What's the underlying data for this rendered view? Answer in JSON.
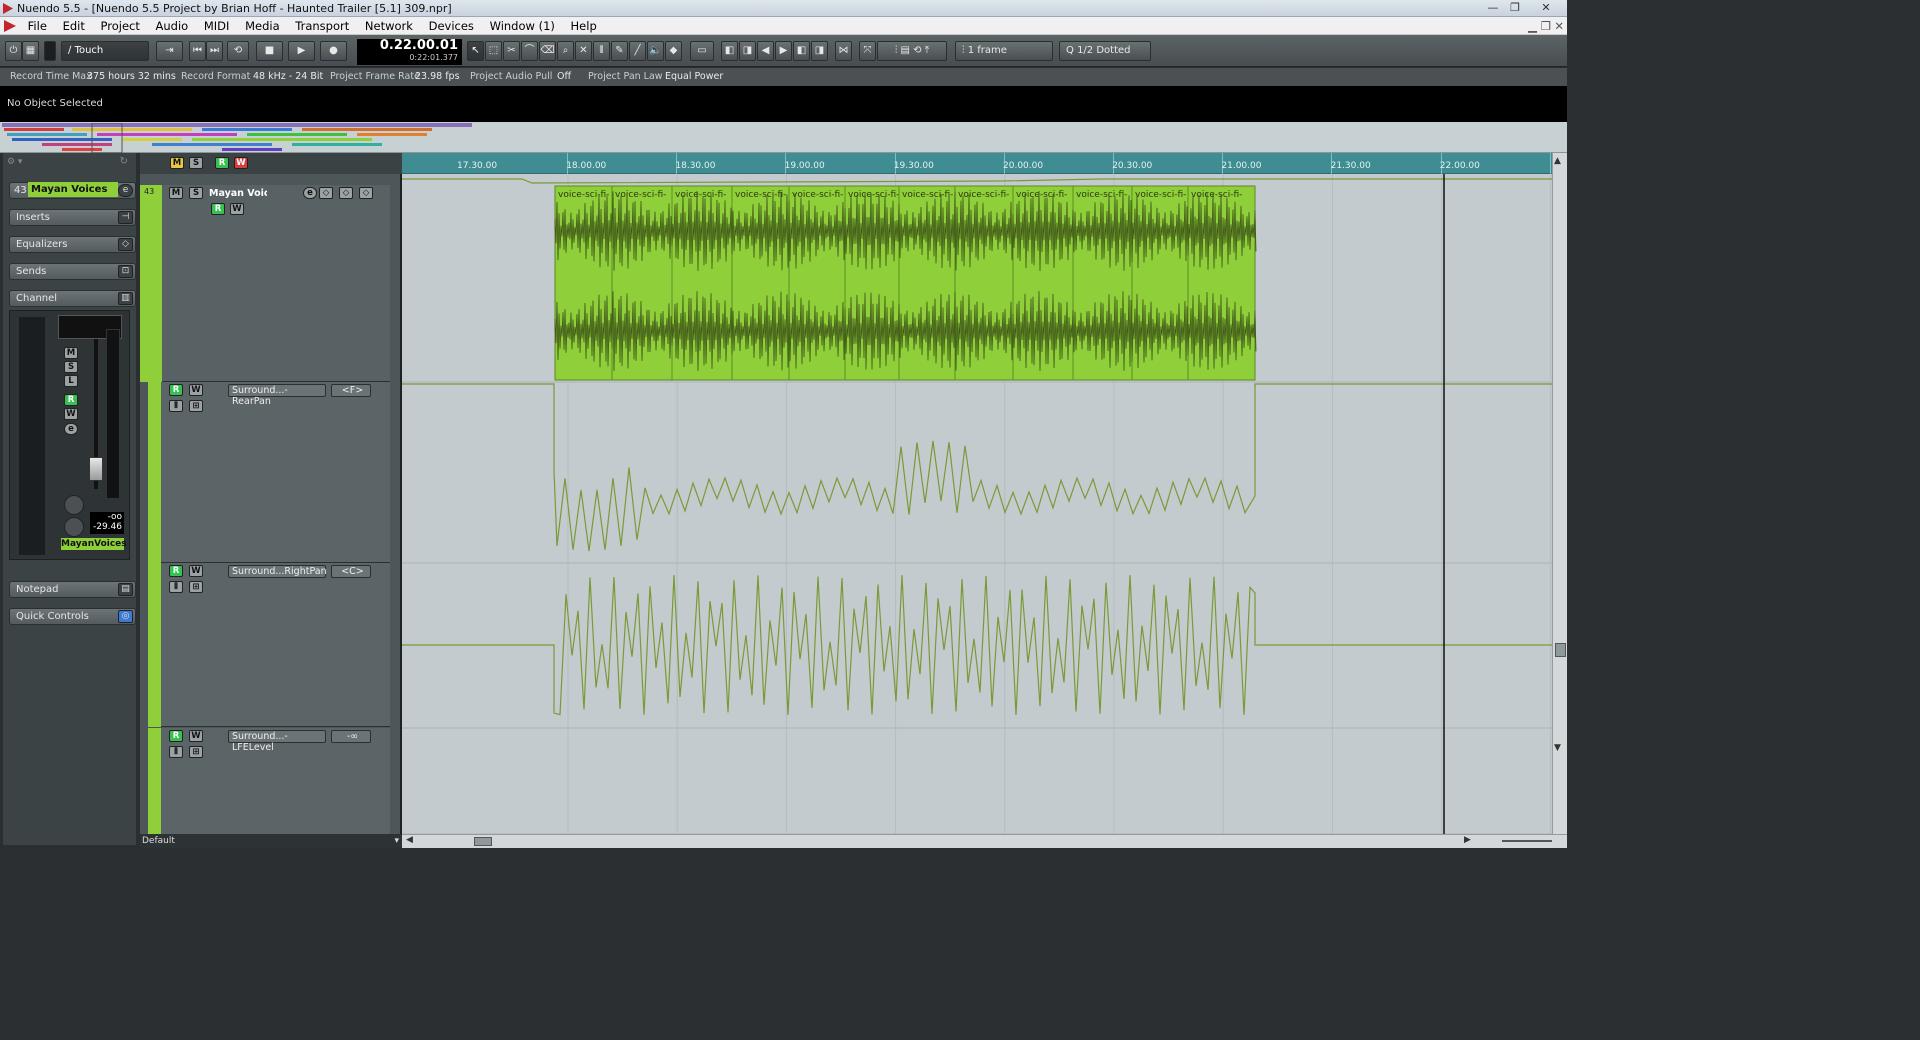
{
  "window": {
    "title": "Nuendo 5.5 - [Nuendo 5.5 Project by Brian Hoff - Haunted Trailer [5.1] 309.npr]",
    "controls": [
      "—",
      "❐",
      "✕"
    ]
  },
  "menu": [
    "File",
    "Edit",
    "Project",
    "Audio",
    "MIDI",
    "Media",
    "Transport",
    "Network",
    "Devices",
    "Window (1)",
    "Help"
  ],
  "toolbar": {
    "automation_mode": "Touch",
    "time_main": "0.22.00.01",
    "time_sub": "0:22:01.377",
    "grid": "1 frame",
    "quantize": "1/2 Dotted"
  },
  "info": {
    "record_time_label": "Record Time Max",
    "record_time_value": "375 hours 32 mins",
    "record_format_label": "Record Format",
    "record_format_value": "48 kHz - 24 Bit",
    "frame_rate_label": "Project Frame Rate",
    "frame_rate_value": "23.98 fps",
    "audio_pull_label": "Project Audio Pull",
    "audio_pull_value": "Off",
    "pan_law_label": "Project Pan Law",
    "pan_law_value": "Equal Power"
  },
  "object_line": "No Object Selected",
  "inspector": {
    "track_number": "43",
    "track_name": "Mayan Voices",
    "sections": [
      "Inserts",
      "Equalizers",
      "Sends",
      "Channel"
    ],
    "lower_sections": [
      "Notepad",
      "Quick Controls"
    ],
    "channel_name": "MayanVoices",
    "meter_peak": "-oo",
    "meter_value": "-29.46"
  },
  "tracks": {
    "audio_track_number": "43",
    "audio_track_name": "Mayan Voices",
    "lanes": [
      {
        "name": "Surround...-RearPan",
        "value": "<F>"
      },
      {
        "name": "Surround...RightPan",
        "value": "<C>"
      },
      {
        "name": "Surround...-LFELevel",
        "value": "-∞"
      }
    ]
  },
  "ruler": {
    "labels": [
      "17.30.00",
      "18.00.00",
      "18.30.00",
      "19.00.00",
      "19.30.00",
      "20.00.00",
      "20.30.00",
      "21.00.00",
      "21.30.00",
      "22.00.00"
    ]
  },
  "event_name": "voice-sci-fi-",
  "footer": {
    "preset": "Default"
  },
  "colors": {
    "event": "#8fcf3a",
    "automation": "#7a9a37",
    "ruler": "#3f8d92"
  }
}
